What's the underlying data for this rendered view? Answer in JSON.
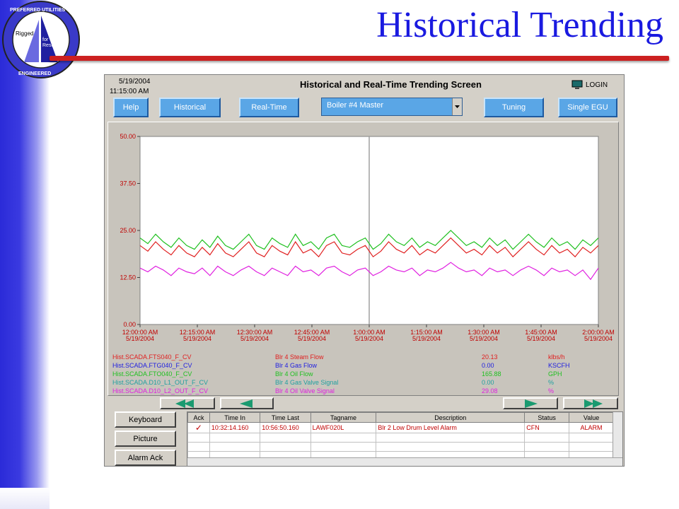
{
  "slide": {
    "title": "Historical Trending",
    "logo_text": [
      "PREFERRED UTILITIES",
      "Rigged",
      "for",
      "Results",
      "ENGINEERED"
    ],
    "colors": {
      "title": "#1a1ae0",
      "rule": "#cc2020",
      "sidebar": "#3030dd"
    }
  },
  "app": {
    "date": "5/19/2004",
    "time": "11:15:00 AM",
    "title": "Historical and Real-Time Trending Screen",
    "login_label": "LOGIN",
    "buttons": {
      "help": "Help",
      "historical": "Historical",
      "realtime": "Real-Time",
      "tuning": "Tuning",
      "single_egu": "Single EGU"
    },
    "dropdown_value": "Boiler #4 Master",
    "side_buttons": {
      "keyboard": "Keyboard",
      "picture": "Picture",
      "alarm_ack": "Alarm Ack"
    }
  },
  "chart_data": {
    "type": "line",
    "ylim": [
      0,
      50
    ],
    "yticks": [
      "50.00",
      "37.50",
      "25.00",
      "12.50",
      "0.00"
    ],
    "xticks": [
      {
        "time": "12:00:00 AM",
        "date": "5/19/2004"
      },
      {
        "time": "12:15:00 AM",
        "date": "5/19/2004"
      },
      {
        "time": "12:30:00 AM",
        "date": "5/19/2004"
      },
      {
        "time": "12:45:00 AM",
        "date": "5/19/2004"
      },
      {
        "time": "1:00:00 AM",
        "date": "5/19/2004"
      },
      {
        "time": "1:15:00 AM",
        "date": "5/19/2004"
      },
      {
        "time": "1:30:00 AM",
        "date": "5/19/2004"
      },
      {
        "time": "1:45:00 AM",
        "date": "5/19/2004"
      },
      {
        "time": "2:00:00 AM",
        "date": "5/19/2004"
      }
    ],
    "cursor_at": "1:00:00 AM",
    "series": [
      {
        "tag": "Hist.SCADA.FTS040_F_CV",
        "description": "Blr 4 Steam Flow",
        "value": "20.13",
        "units": "klbs/h",
        "color": "#e02020",
        "values": [
          21,
          19.5,
          22,
          20,
          18.5,
          21,
          19,
          18,
          20.5,
          18.5,
          21.5,
          19,
          18,
          20,
          22,
          19,
          18,
          21,
          19.5,
          18.5,
          22,
          19,
          20,
          18,
          21,
          22,
          19,
          18.5,
          20,
          21,
          18,
          19.5,
          22,
          20,
          19,
          21,
          18.5,
          20,
          19,
          21,
          23,
          21,
          19,
          20,
          18.5,
          21,
          19,
          20.5,
          18,
          20,
          22,
          20,
          18.5,
          21,
          19,
          20,
          18,
          20.5,
          19,
          21
        ]
      },
      {
        "tag": "Hist.SCADA.FTG040_F_CV",
        "description": "Blr 4 Gas Flow",
        "value": "0.00",
        "units": "KSCFH",
        "color": "#2020e0",
        "values": [
          0,
          0,
          0,
          0,
          0,
          0,
          0,
          0,
          0,
          0,
          0,
          0,
          0,
          0,
          0,
          0,
          0,
          0,
          0,
          0,
          0,
          0,
          0,
          0,
          0,
          0,
          0,
          0,
          0,
          0,
          0,
          0,
          0,
          0,
          0,
          0,
          0,
          0,
          0,
          0,
          0,
          0,
          0,
          0,
          0,
          0,
          0,
          0,
          0,
          0,
          0,
          0,
          0,
          0,
          0,
          0,
          0,
          0,
          0,
          0
        ]
      },
      {
        "tag": "Hist.SCADA.FTO040_F_CV",
        "description": "Blr 4 Oil Flow",
        "value": "165.88",
        "units": "GPH",
        "color": "#20c020",
        "values": [
          23,
          21.5,
          24,
          22,
          20.5,
          23,
          21,
          20,
          22.5,
          20.5,
          23.5,
          21,
          20,
          22,
          24,
          21,
          20,
          23,
          21.5,
          20.5,
          24,
          21,
          22,
          20,
          23,
          24,
          21,
          20.5,
          22,
          23,
          20,
          21.5,
          24,
          22,
          21,
          23,
          20.5,
          22,
          21,
          23,
          25,
          23,
          21,
          22,
          20.5,
          23,
          21,
          22.5,
          20,
          22,
          24,
          22,
          20.5,
          23,
          21,
          22,
          20,
          22.5,
          21,
          23
        ]
      },
      {
        "tag": "Hist.SCADA.D10_L1_OUT_F_CV",
        "description": "Blr 4 Gas Valve Signal",
        "value": "0.00",
        "units": "%",
        "color": "#20a0a0",
        "values": [
          0,
          0,
          0,
          0,
          0,
          0,
          0,
          0,
          0,
          0,
          0,
          0,
          0,
          0,
          0,
          0,
          0,
          0,
          0,
          0,
          0,
          0,
          0,
          0,
          0,
          0,
          0,
          0,
          0,
          0,
          0,
          0,
          0,
          0,
          0,
          0,
          0,
          0,
          0,
          0,
          0,
          0,
          0,
          0,
          0,
          0,
          0,
          0,
          0,
          0,
          0,
          0,
          0,
          0,
          0,
          0,
          0,
          0,
          0,
          0
        ]
      },
      {
        "tag": "Hist.SCADA.D10_L2_OUT_F_CV",
        "description": "Blr 4 Oil Valve Signal",
        "value": "29.08",
        "units": "%",
        "color": "#e020e0",
        "values": [
          15,
          14,
          15.5,
          14.5,
          13,
          15,
          14,
          13.5,
          15,
          13,
          15.5,
          14,
          13,
          14.5,
          15.5,
          14,
          13,
          15,
          14,
          13,
          15.5,
          14,
          14.5,
          13,
          15,
          15.5,
          14,
          13,
          14.5,
          15,
          13,
          14,
          15.5,
          14.5,
          14,
          15,
          13,
          14.5,
          14,
          15,
          16.5,
          15,
          14,
          14.5,
          13,
          15,
          14,
          14.5,
          13,
          14.5,
          15.5,
          14.5,
          13,
          15,
          14,
          14.5,
          13,
          14.5,
          12,
          15
        ]
      }
    ]
  },
  "alarms": {
    "columns": [
      "Ack",
      "Time In",
      "Time Last",
      "Tagname",
      "Description",
      "Status",
      "Value"
    ],
    "rows": [
      {
        "ack": "✓",
        "time_in": "10:32:14.160",
        "time_last": "10:56:50.160",
        "tagname": "LAWF020L",
        "description": "Blr 2 Low Drum Level Alarm",
        "status": "CFN",
        "value": "ALARM"
      }
    ]
  }
}
